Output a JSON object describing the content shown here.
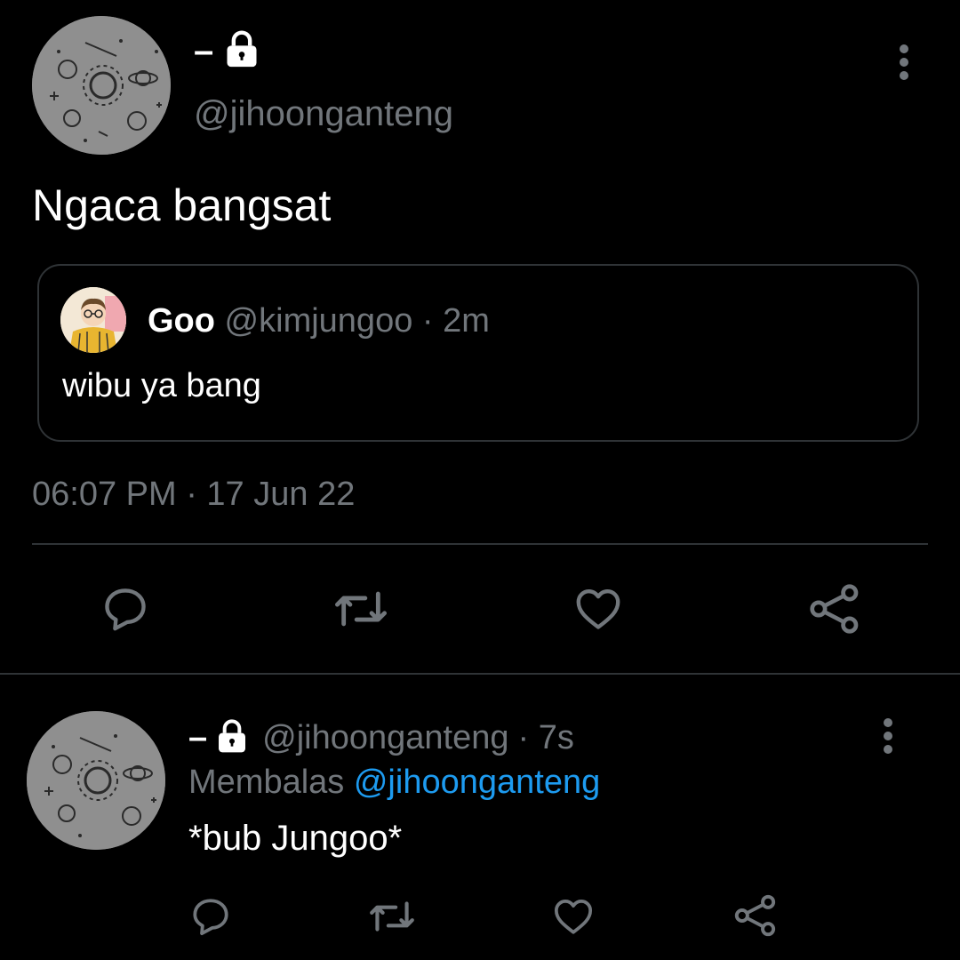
{
  "main_tweet": {
    "display_name": "–",
    "handle": "@jihoonganteng",
    "text": "Ngaca bangsat",
    "timestamp": "06:07 PM · 17 Jun 22",
    "quoted": {
      "name": "Goo",
      "handle": "@kimjungoo",
      "time": "· 2m",
      "text": "wibu ya bang"
    }
  },
  "reply": {
    "display_name": "–",
    "handle": "@jihoonganteng",
    "time": "· 7s",
    "replying_label": "Membalas",
    "replying_to": "@jihoonganteng",
    "text": "*bub Jungoo*"
  },
  "icons": [
    "lock-icon",
    "more-icon",
    "reply-icon",
    "retweet-icon",
    "like-icon",
    "share-icon"
  ],
  "colors": {
    "background": "#000000",
    "text": "#e7e9ea",
    "secondary": "#71767b",
    "link": "#1d9bf0",
    "border": "#2f3336"
  }
}
